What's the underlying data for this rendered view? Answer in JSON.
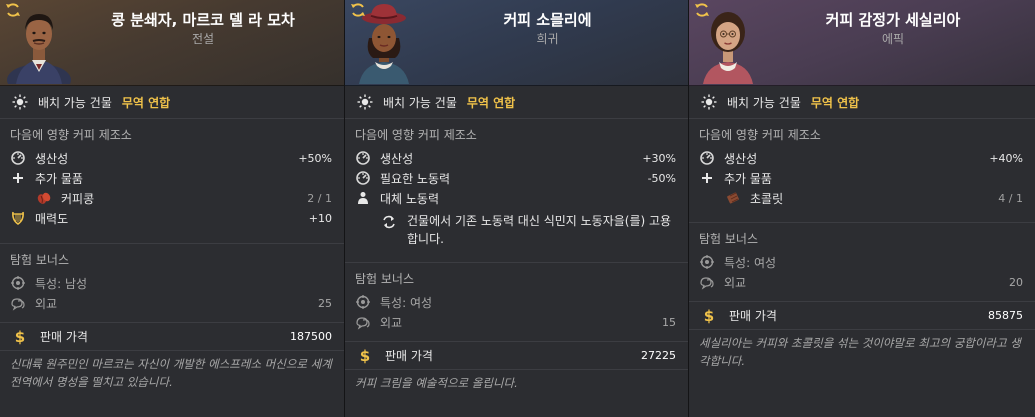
{
  "cards": [
    {
      "name": "콩 분쇄자, 마르코 델 라 모차",
      "rarity": "전설",
      "portrait_icon": "portrait-man-icon",
      "building_label": "배치 가능 건물",
      "building_value": "무역 연합",
      "affects_title": "다음에 영향 커피 제조소",
      "effects": [
        {
          "icon": "productivity-icon",
          "label": "생산성",
          "value": "+50%"
        },
        {
          "icon": "plus-icon",
          "label": "추가 물품",
          "value": ""
        },
        {
          "icon": "coffee-beans-icon",
          "label": "커피콩",
          "value": "2 / 1",
          "sub": true
        },
        {
          "icon": "lyre-icon",
          "label": "매력도",
          "value": "+10"
        }
      ],
      "expedition_title": "탐험 보너스",
      "expedition": [
        {
          "icon": "trait-icon",
          "label": "특성:  남성",
          "value": ""
        },
        {
          "icon": "diplomacy-icon",
          "label": "외교",
          "value": "25"
        }
      ],
      "price_label": "판매 가격",
      "price_value": "187500",
      "flavor": "신대륙 원주민인 마르코는 자신이 개발한 에스프레소 머신으로 세계 전역에서 명성을 떨치고 있습니다."
    },
    {
      "name": "커피 소믈리에",
      "rarity": "희귀",
      "portrait_icon": "portrait-woman-hat-icon",
      "building_label": "배치 가능 건물",
      "building_value": "무역 연합",
      "affects_title": "다음에 영향 커피 제조소",
      "effects": [
        {
          "icon": "productivity-icon",
          "label": "생산성",
          "value": "+30%"
        },
        {
          "icon": "productivity-icon",
          "label": "필요한 노동력",
          "value": "-50%"
        },
        {
          "icon": "workforce-icon",
          "label": "대체 노동력",
          "value": ""
        }
      ],
      "replace_text": "건물에서 기존 노동력 대신 식민지 노동자을(를) 고용합니다.",
      "expedition_title": "탐험 보너스",
      "expedition": [
        {
          "icon": "trait-icon",
          "label": "특성:  여성",
          "value": ""
        },
        {
          "icon": "diplomacy-icon",
          "label": "외교",
          "value": "15"
        }
      ],
      "price_label": "판매 가격",
      "price_value": "27225",
      "flavor": "커피 크림을 예술적으로 올립니다."
    },
    {
      "name": "커피 감정가 세실리아",
      "rarity": "에픽",
      "portrait_icon": "portrait-woman-icon",
      "building_label": "배치 가능 건물",
      "building_value": "무역 연합",
      "affects_title": "다음에 영향 커피 제조소",
      "effects": [
        {
          "icon": "productivity-icon",
          "label": "생산성",
          "value": "+40%"
        },
        {
          "icon": "plus-icon",
          "label": "추가 물품",
          "value": ""
        },
        {
          "icon": "chocolate-icon",
          "label": "초콜릿",
          "value": "4 / 1",
          "sub": true
        }
      ],
      "expedition_title": "탐험 보너스",
      "expedition": [
        {
          "icon": "trait-icon",
          "label": "특성:  여성",
          "value": ""
        },
        {
          "icon": "diplomacy-icon",
          "label": "외교",
          "value": "20"
        }
      ],
      "price_label": "판매 가격",
      "price_value": "85875",
      "flavor": "세실리아는 커피와 초콜릿을 섞는 것이야말로 최고의 궁합이라고 생각합니다."
    }
  ],
  "colors": {
    "accent": "#f0c24a",
    "muted": "#a8a8a8"
  }
}
